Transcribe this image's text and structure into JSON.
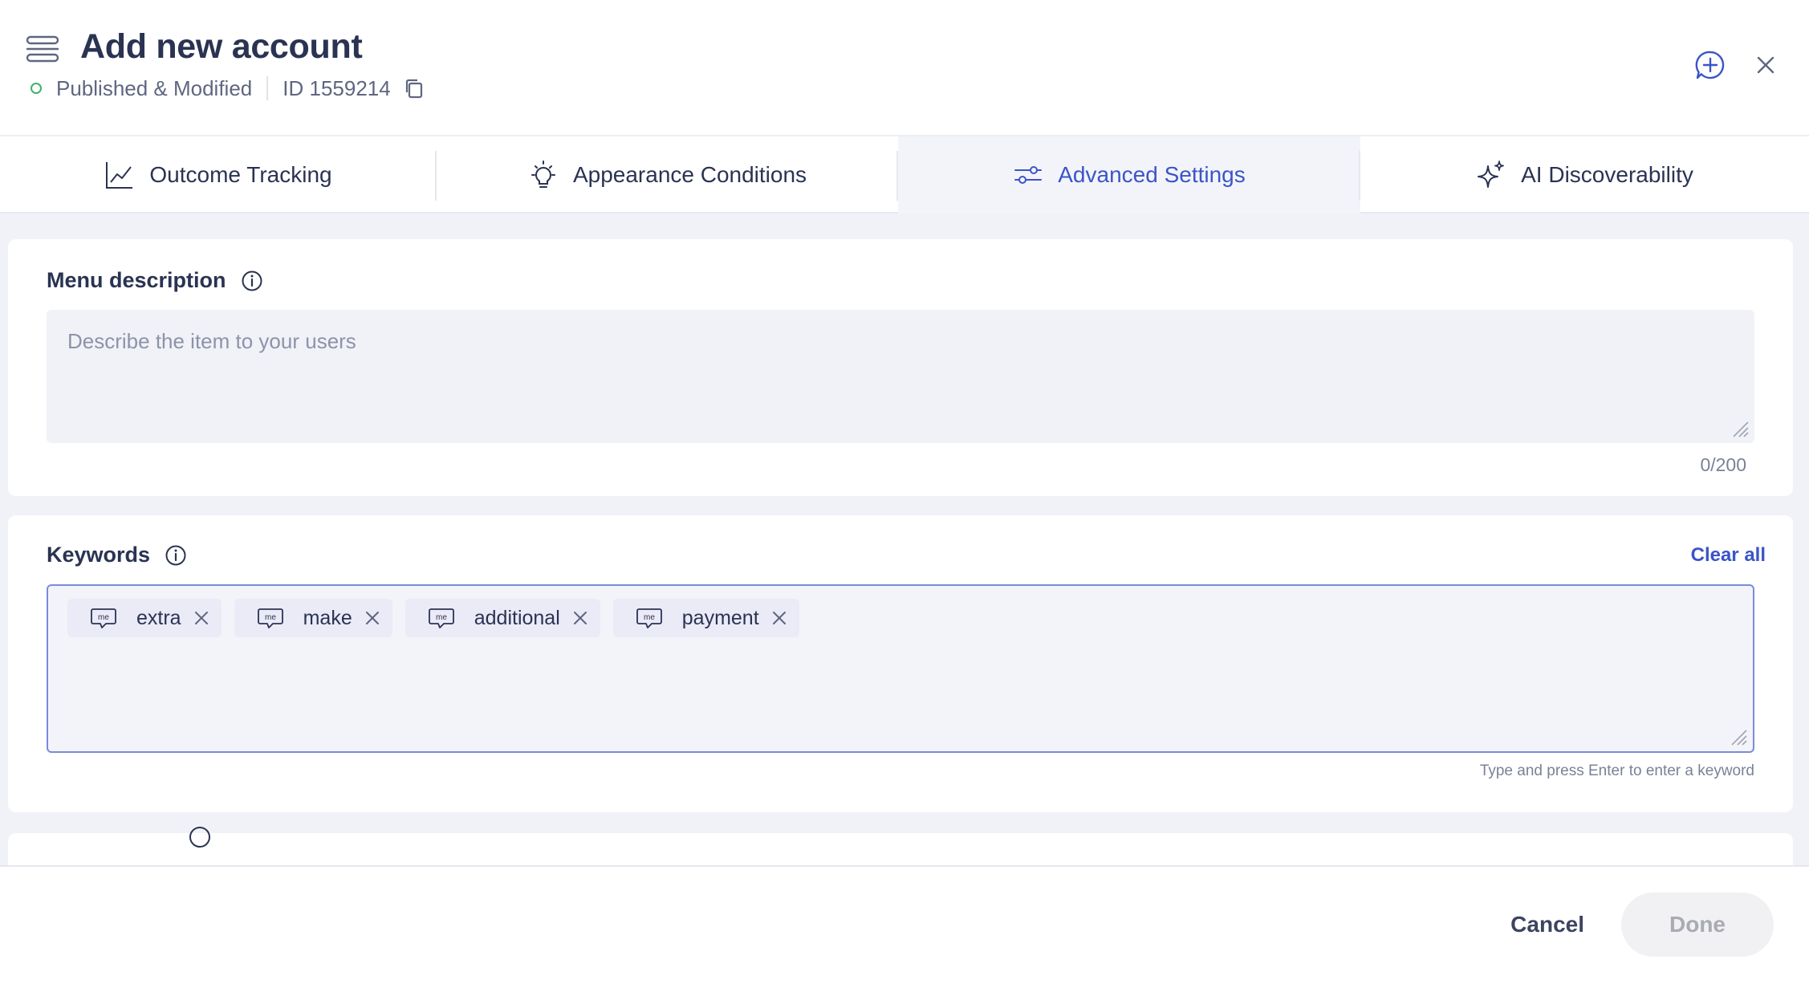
{
  "header": {
    "title": "Add new account",
    "status": "Published & Modified",
    "id_label": "ID 1559214",
    "colors": {
      "status": "#3fb26b",
      "accent": "#3a54c8"
    }
  },
  "tabs": [
    {
      "label": "Outcome Tracking",
      "icon": "line-chart-icon",
      "active": false
    },
    {
      "label": "Appearance Conditions",
      "icon": "lightbulb-icon",
      "active": false
    },
    {
      "label": "Advanced Settings",
      "icon": "sliders-icon",
      "active": true
    },
    {
      "label": "AI Discoverability",
      "icon": "sparkle-icon",
      "active": false
    }
  ],
  "menu_description": {
    "label": "Menu description",
    "placeholder": "Describe the item to your users",
    "counter": "0/200"
  },
  "keywords": {
    "label": "Keywords",
    "clear_all": "Clear all",
    "chips": [
      "extra",
      "make",
      "additional",
      "payment"
    ],
    "hint": "Type and press Enter to enter a keyword"
  },
  "footer": {
    "cancel": "Cancel",
    "done": "Done"
  }
}
